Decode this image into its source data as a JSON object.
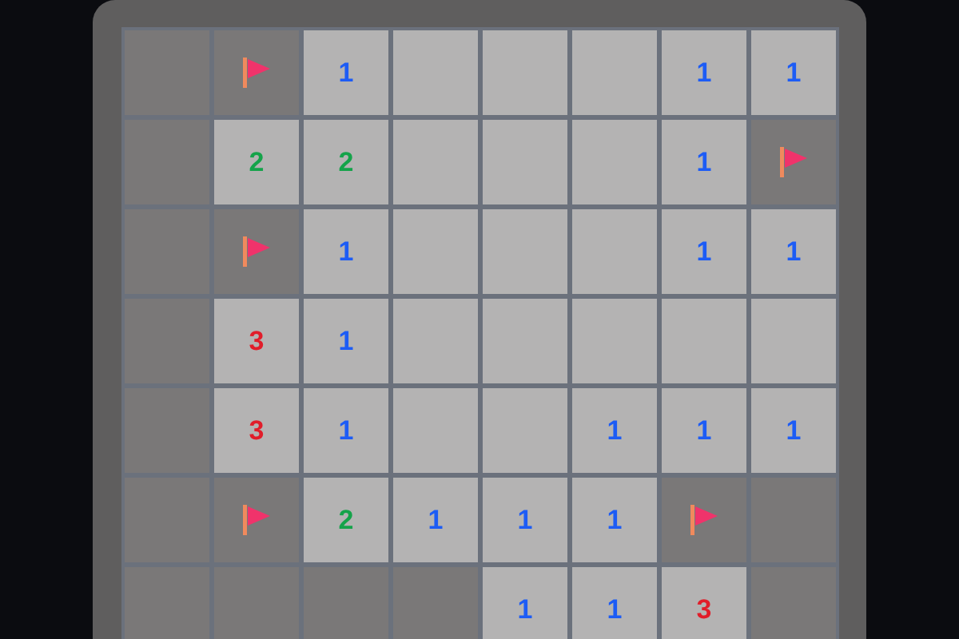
{
  "board": {
    "rows": [
      [
        {
          "kind": "hidden"
        },
        {
          "kind": "flag"
        },
        {
          "kind": "number",
          "text": "1",
          "color": "#1d5cf5"
        },
        {
          "kind": "empty"
        },
        {
          "kind": "empty"
        },
        {
          "kind": "empty"
        },
        {
          "kind": "number",
          "text": "1",
          "color": "#1d5cf5"
        },
        {
          "kind": "number",
          "text": "1",
          "color": "#1d5cf5"
        }
      ],
      [
        {
          "kind": "hidden"
        },
        {
          "kind": "number",
          "text": "2",
          "color": "#15a34a"
        },
        {
          "kind": "number",
          "text": "2",
          "color": "#15a34a"
        },
        {
          "kind": "empty"
        },
        {
          "kind": "empty"
        },
        {
          "kind": "empty"
        },
        {
          "kind": "number",
          "text": "1",
          "color": "#1d5cf5"
        },
        {
          "kind": "flag"
        }
      ],
      [
        {
          "kind": "hidden"
        },
        {
          "kind": "flag"
        },
        {
          "kind": "number",
          "text": "1",
          "color": "#1d5cf5"
        },
        {
          "kind": "empty"
        },
        {
          "kind": "empty"
        },
        {
          "kind": "empty"
        },
        {
          "kind": "number",
          "text": "1",
          "color": "#1d5cf5"
        },
        {
          "kind": "number",
          "text": "1",
          "color": "#1d5cf5"
        }
      ],
      [
        {
          "kind": "hidden"
        },
        {
          "kind": "number",
          "text": "3",
          "color": "#e11d2a"
        },
        {
          "kind": "number",
          "text": "1",
          "color": "#1d5cf5"
        },
        {
          "kind": "empty"
        },
        {
          "kind": "empty"
        },
        {
          "kind": "empty"
        },
        {
          "kind": "empty"
        },
        {
          "kind": "empty"
        }
      ],
      [
        {
          "kind": "hidden"
        },
        {
          "kind": "number",
          "text": "3",
          "color": "#e11d2a"
        },
        {
          "kind": "number",
          "text": "1",
          "color": "#1d5cf5"
        },
        {
          "kind": "empty"
        },
        {
          "kind": "empty"
        },
        {
          "kind": "number",
          "text": "1",
          "color": "#1d5cf5"
        },
        {
          "kind": "number",
          "text": "1",
          "color": "#1d5cf5"
        },
        {
          "kind": "number",
          "text": "1",
          "color": "#1d5cf5"
        }
      ],
      [
        {
          "kind": "hidden"
        },
        {
          "kind": "flag"
        },
        {
          "kind": "number",
          "text": "2",
          "color": "#15a34a"
        },
        {
          "kind": "number",
          "text": "1",
          "color": "#1d5cf5"
        },
        {
          "kind": "number",
          "text": "1",
          "color": "#1d5cf5"
        },
        {
          "kind": "number",
          "text": "1",
          "color": "#1d5cf5"
        },
        {
          "kind": "flag"
        },
        {
          "kind": "hidden"
        }
      ],
      [
        {
          "kind": "hidden"
        },
        {
          "kind": "hidden"
        },
        {
          "kind": "hidden"
        },
        {
          "kind": "hidden"
        },
        {
          "kind": "number",
          "text": "1",
          "color": "#1d5cf5"
        },
        {
          "kind": "number",
          "text": "1",
          "color": "#1d5cf5"
        },
        {
          "kind": "number",
          "text": "3",
          "color": "#e11d2a"
        },
        {
          "kind": "hidden"
        }
      ]
    ]
  }
}
